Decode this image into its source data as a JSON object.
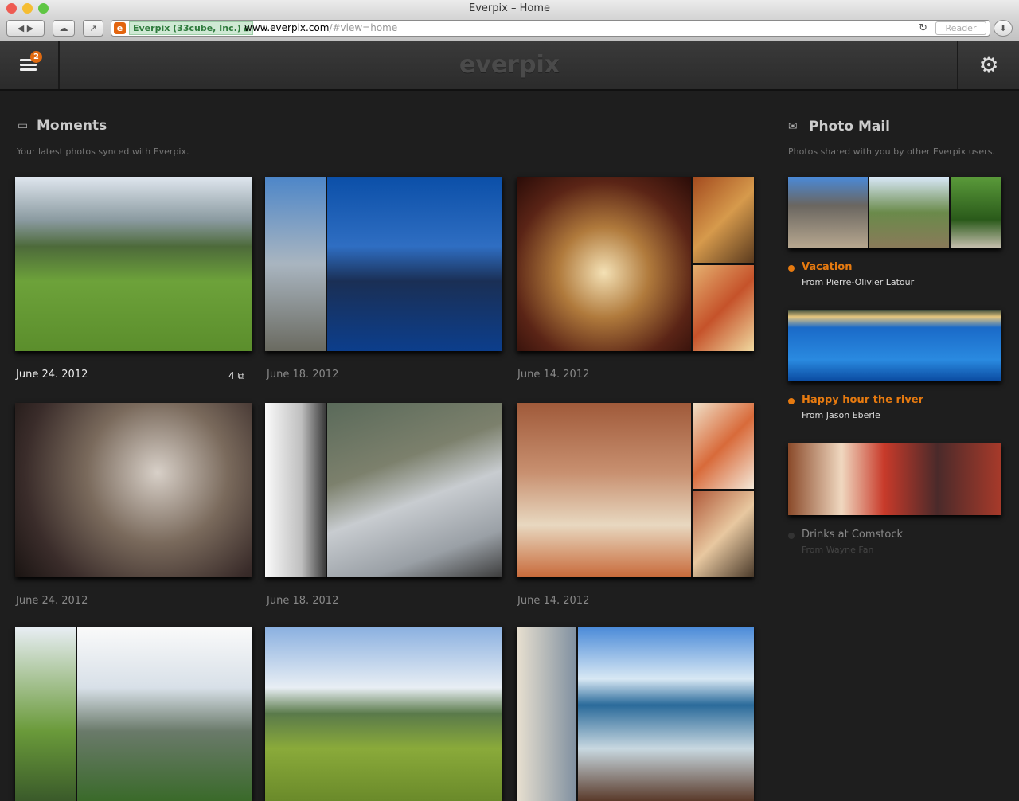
{
  "window": {
    "title": "Everpix – Home"
  },
  "browser": {
    "ev_label": "Everpix (33cube, Inc.)",
    "url_host": "www.everpix.com",
    "url_path": "/#view=home",
    "reader": "Reader",
    "favicon": "e"
  },
  "app": {
    "logo": "everpix",
    "notification_count": "2"
  },
  "moments": {
    "title": "Moments",
    "subtitle": "Your latest photos synced with Everpix.",
    "items": [
      {
        "date": "June 24. 2012",
        "count": "4"
      },
      {
        "date": "June 18. 2012"
      },
      {
        "date": "June 14. 2012"
      },
      {
        "date": "June 24. 2012"
      },
      {
        "date": "June 18. 2012"
      },
      {
        "date": "June 14. 2012"
      }
    ]
  },
  "photo_mail": {
    "title": "Photo Mail",
    "subtitle": "Photos shared with you by other Everpix users.",
    "items": [
      {
        "title": "Vacation",
        "from": "From Pierre-Olivier Latour",
        "unread": true
      },
      {
        "title": "Happy hour the river",
        "from": "From Jason Eberle",
        "unread": true
      },
      {
        "title": "Drinks at Comstock",
        "from": "From Wayne Fan",
        "unread": false
      }
    ]
  },
  "colors": {
    "accent": "#e67a10",
    "background": "#1e1e1e"
  }
}
